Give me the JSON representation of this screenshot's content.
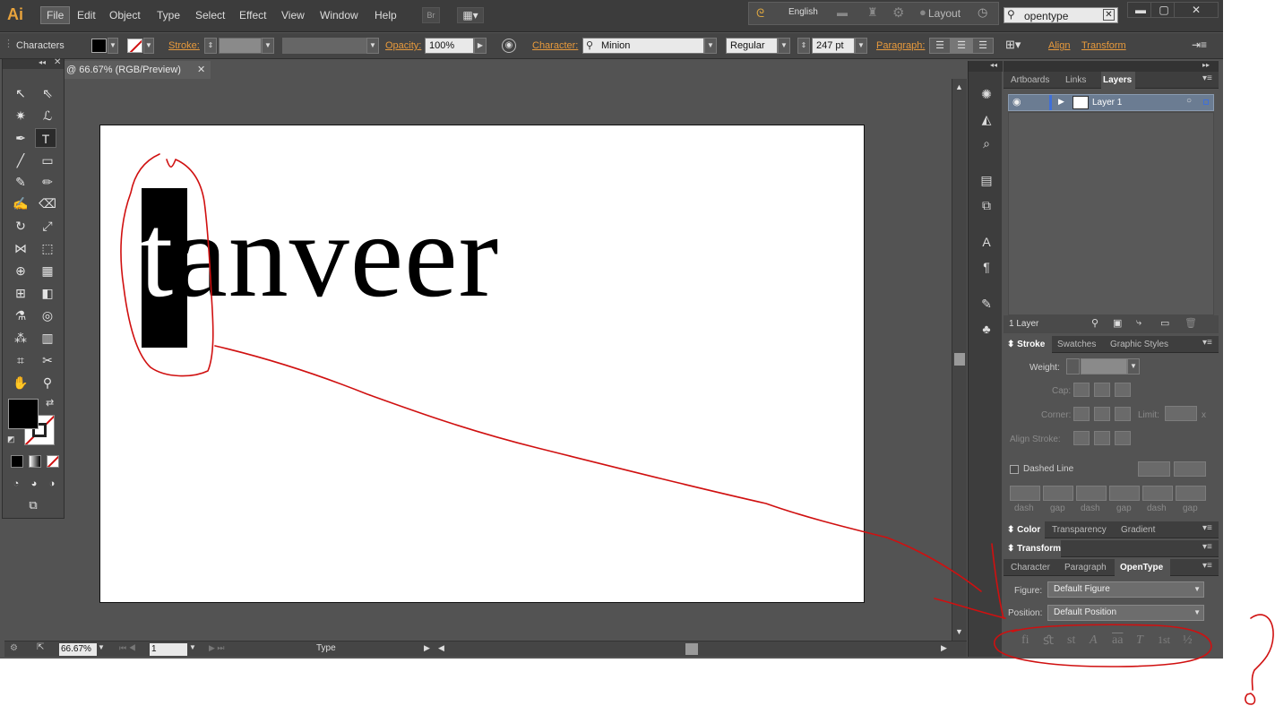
{
  "app": {
    "logo": "Ai"
  },
  "menu": [
    "File",
    "Edit",
    "Object",
    "Type",
    "Select",
    "Effect",
    "View",
    "Window",
    "Help"
  ],
  "menubar": {
    "bridge_label": "Br",
    "language": "English",
    "workspace": "Layout",
    "search_value": "opentype"
  },
  "control": {
    "mode": "Characters",
    "stroke_label": "Stroke:",
    "opacity_label": "Opacity:",
    "opacity_value": "100%",
    "character_label": "Character:",
    "font_value": "Minion",
    "style_value": "Regular",
    "size_value": "247 pt",
    "paragraph_label": "Paragraph:",
    "align_label": "Align",
    "transform_label": "Transform"
  },
  "document": {
    "tab_title": "@ 66.67% (RGB/Preview)",
    "art_text_first": "t",
    "art_text_rest": "anveer"
  },
  "status": {
    "zoom": "66.67%",
    "page": "1",
    "tool": "Type"
  },
  "layers_panel": {
    "tabs": [
      "Artboards",
      "Links",
      "Layers"
    ],
    "active_tab": "Layers",
    "layer_name": "Layer 1",
    "count": "1 Layer"
  },
  "stroke_panel": {
    "tabs": [
      "Stroke",
      "Swatches",
      "Graphic Styles"
    ],
    "weight_label": "Weight:",
    "cap_label": "Cap:",
    "corner_label": "Corner:",
    "limit_label": "Limit:",
    "limit_unit": "x",
    "align_label": "Align Stroke:",
    "dashed_label": "Dashed Line",
    "dash_labels": [
      "dash",
      "gap",
      "dash",
      "gap",
      "dash",
      "gap"
    ]
  },
  "color_panel": {
    "tabs": [
      "Color",
      "Transparency",
      "Gradient"
    ]
  },
  "transform_panel": {
    "title": "Transform"
  },
  "opentype_panel": {
    "tabs": [
      "Character",
      "Paragraph",
      "OpenType"
    ],
    "figure_label": "Figure:",
    "figure_value": "Default Figure",
    "position_label": "Position:",
    "position_value": "Default Position",
    "glyph_buttons": [
      "fi",
      "ﬆ",
      "st",
      "A",
      "aa",
      "T",
      "1st",
      "½"
    ]
  },
  "colors": {
    "accent_orange": "#e89a3c",
    "annotation_red": "#d01010",
    "panel_bg": "#535353"
  }
}
